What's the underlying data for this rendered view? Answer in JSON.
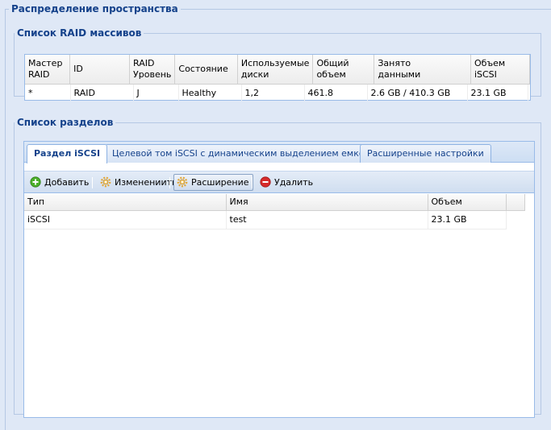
{
  "outer_title": "Распределение пространства",
  "raid_section": {
    "title": "Список RAID массивов",
    "columns": [
      "Мастер\nRAID",
      "ID",
      "RAID\nУровень",
      "Состояние",
      "Используемые\nдиски",
      "Общий\nобъем",
      "Занято\nданными",
      "Объем\niSCSI"
    ],
    "rows": [
      [
        "*",
        "RAID",
        "J",
        "Healthy",
        "1,2",
        "461.8",
        "2.6 GB / 410.3 GB",
        "23.1 GB"
      ]
    ]
  },
  "partition_section": {
    "title": "Список разделов",
    "tabs": [
      "Раздел iSCSI",
      "Целевой том iSCSI с динамическим выделением емкости",
      "Расширенные настройки"
    ],
    "active_tab": 0,
    "toolbar": {
      "add": "Добавить",
      "edit": "Изменениить",
      "expand": "Расширение",
      "delete": "Удалить"
    },
    "columns": [
      "Тип",
      "Имя",
      "Объем"
    ],
    "rows": [
      [
        "iSCSI",
        "test",
        "23.1 GB"
      ]
    ]
  },
  "icons": {
    "add": "plus-circle-icon",
    "edit": "gear-icon",
    "expand": "gear-icon",
    "delete": "minus-circle-icon"
  },
  "colors": {
    "background": "#dfe8f6",
    "header_text": "#15428b",
    "border": "#99bbe8",
    "add_icon": "#4caf2a",
    "delete_icon": "#d62b2b",
    "gear_icon": "#e2a83a"
  }
}
